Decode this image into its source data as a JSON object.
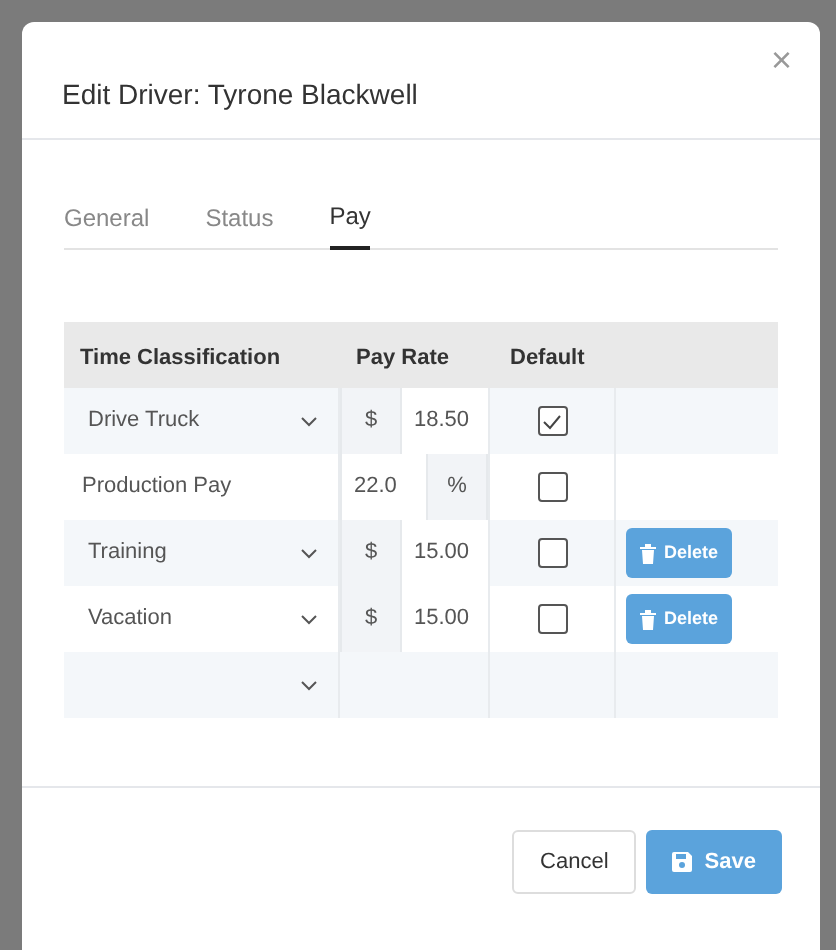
{
  "dialog": {
    "title": "Edit Driver: Tyrone Blackwell",
    "close": "×"
  },
  "tabs": [
    {
      "label": "General",
      "selected": false
    },
    {
      "label": "Status",
      "selected": false
    },
    {
      "label": "Pay",
      "selected": true
    }
  ],
  "table": {
    "columns": [
      "Time Classification",
      "Pay Rate",
      "Default"
    ],
    "rows": [
      {
        "kind": "select",
        "classification": "Drive Truck",
        "prefix": "$",
        "rate": "18.50",
        "default": true
      },
      {
        "kind": "fixed",
        "classification": "Production Pay",
        "percent": "22.0",
        "suffix": "%",
        "default": false
      },
      {
        "kind": "select",
        "classification": "Training",
        "prefix": "$",
        "rate": "15.00",
        "default": false,
        "action": "Delete"
      },
      {
        "kind": "select",
        "classification": "Vacation",
        "prefix": "$",
        "rate": "15.00",
        "default": false,
        "action": "Delete"
      },
      {
        "kind": "blank"
      }
    ]
  },
  "buttons": [
    {
      "label": "Cancel",
      "kind": "secondary"
    },
    {
      "label": "Save",
      "kind": "primary"
    }
  ]
}
